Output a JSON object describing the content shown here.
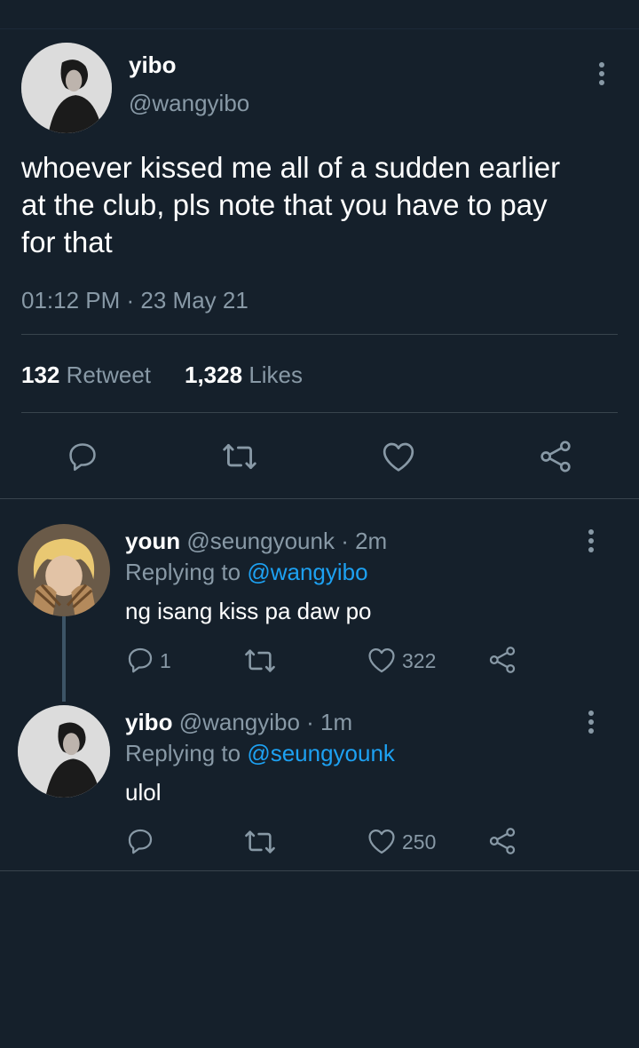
{
  "main_tweet": {
    "display_name": "yibo",
    "handle": "@wangyibo",
    "text_lines": [
      "whoever kissed me all of a sudden earlier",
      "at the club, pls note that you have to pay",
      "for that"
    ],
    "timestamp": "01:12 PM · 23 May 21",
    "retweet_count": "132",
    "retweet_label": "Retweet",
    "like_count": "1,328",
    "like_label": "Likes"
  },
  "replies": [
    {
      "display_name": "youn",
      "handle": "@seungyounk",
      "time": "· 2m",
      "replying_label": "Replying to",
      "replying_to": "@wangyibo",
      "text": "ng isang kiss pa daw po",
      "reply_count": "1",
      "like_count": "322"
    },
    {
      "display_name": "yibo",
      "handle": "@wangyibo",
      "time": "· 1m",
      "replying_label": "Replying to",
      "replying_to": "@seungyounk",
      "text": "ulol",
      "reply_count": "",
      "like_count": "250"
    }
  ],
  "icons": {
    "reply": "reply-icon",
    "retweet": "retweet-icon",
    "like": "heart-icon",
    "share": "share-icon",
    "more": "more-vertical-icon"
  },
  "colors": {
    "background": "#15202b",
    "muted_text": "#8899a6",
    "link": "#1da1f2",
    "divider": "#38444d"
  }
}
